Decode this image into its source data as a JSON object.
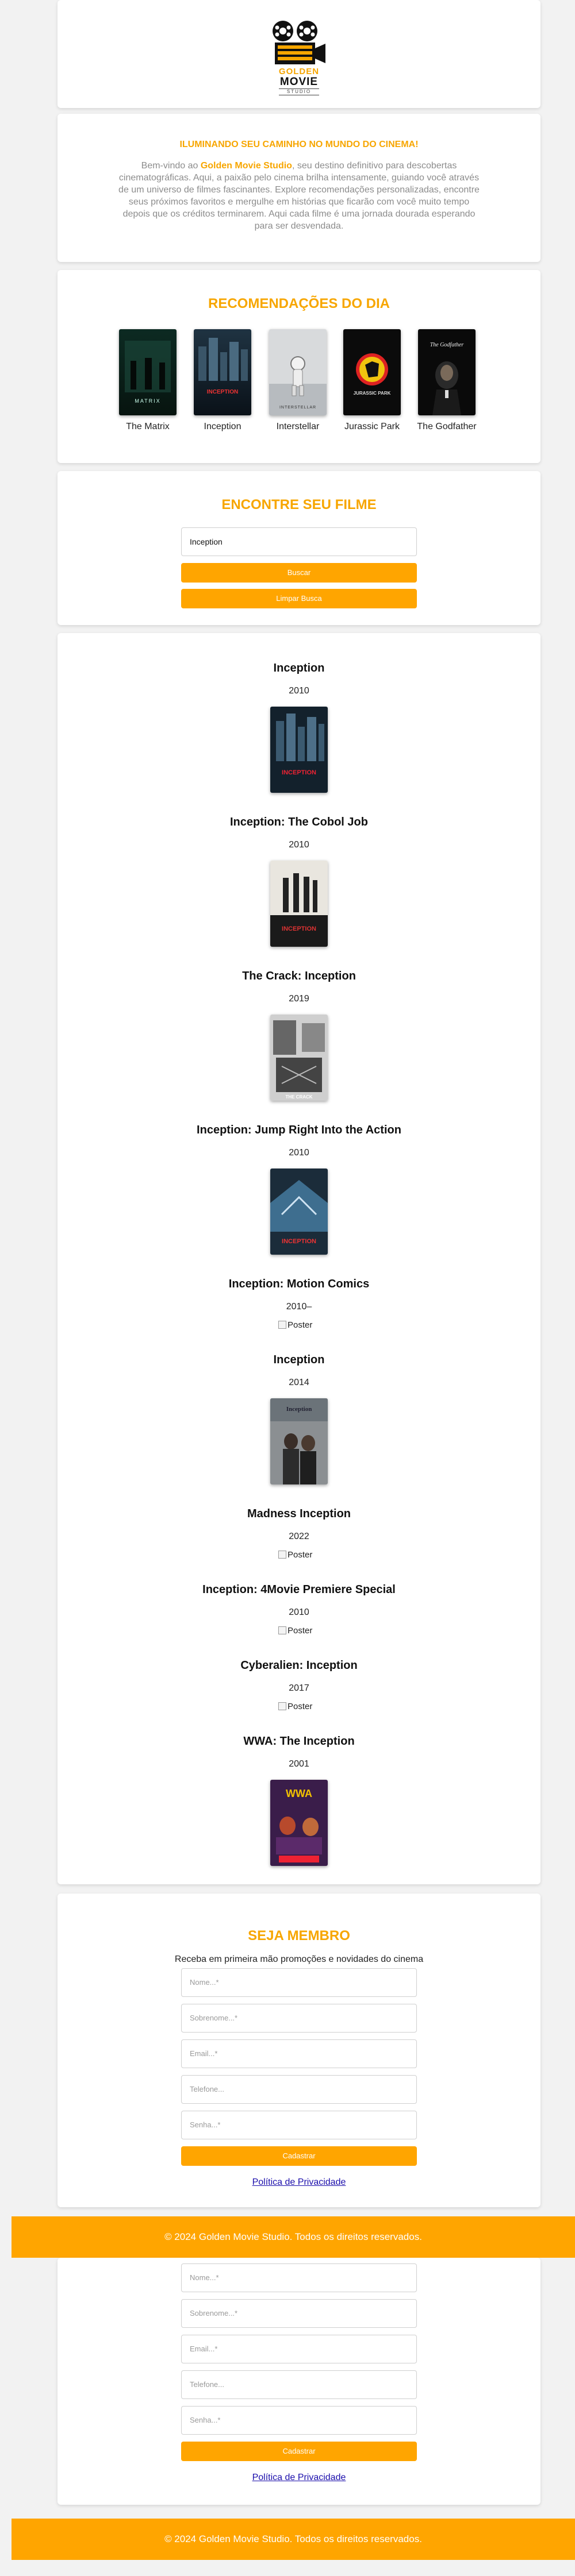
{
  "brand": {
    "logo_line1": "GOLDEN",
    "logo_line2": "MOVIE",
    "logo_line3": "STUDIO",
    "accent": "#ffa500"
  },
  "intro": {
    "headline": "ILUMINANDO SEU CAMINHO NO MUNDO DO CINEMA!",
    "text_before": "Bem-vindo ao ",
    "brand_name": "Golden Movie Studio",
    "text_after": ", seu destino definitivo para descobertas cinematográficas. Aqui, a paixão pelo cinema brilha intensamente, guiando você através de um universo de filmes fascinantes. Explore recomendações personalizadas, encontre seus próximos favoritos e mergulhe em histórias que ficarão com você muito tempo depois que os créditos terminarem. Aqui cada filme é uma jornada dourada esperando para ser desvendada."
  },
  "recommendations": {
    "title": "RECOMENDAÇÕES DO DIA",
    "items": [
      {
        "name": "The Matrix",
        "poster_text": "MATRIX"
      },
      {
        "name": "Inception",
        "poster_text": "INCEPTION"
      },
      {
        "name": "Interstellar",
        "poster_text": "INTERSTELLAR"
      },
      {
        "name": "Jurassic Park",
        "poster_text": "JURASSIC PARK"
      },
      {
        "name": "The Godfather",
        "poster_text": "The Godfather"
      }
    ]
  },
  "search": {
    "title": "ENCONTRE SEU FILME",
    "value": "Inception",
    "search_button": "Buscar",
    "clear_button": "Limpar Busca"
  },
  "results": [
    {
      "title": "Inception",
      "year": "2010",
      "poster_text": "INCEPTION"
    },
    {
      "title": "Inception: The Cobol Job",
      "year": "2010",
      "poster_text": "INCEPTION"
    },
    {
      "title": "The Crack: Inception",
      "year": "2019",
      "poster_text": "THE CRACK"
    },
    {
      "title": "Inception: Jump Right Into the Action",
      "year": "2010",
      "poster_text": "INCEPTION"
    },
    {
      "title": "Inception: Motion Comics",
      "year": "2010–",
      "broken_alt": "Poster"
    },
    {
      "title": "Inception",
      "year": "2014",
      "poster_text": "Inception"
    },
    {
      "title": "Madness Inception",
      "year": "2022",
      "broken_alt": "Poster"
    },
    {
      "title": "Inception: 4Movie Premiere Special",
      "year": "2010",
      "broken_alt": "Poster"
    },
    {
      "title": "Cyberalien: Inception",
      "year": "2017",
      "broken_alt": "Poster"
    },
    {
      "title": "WWA: The Inception",
      "year": "2001",
      "poster_text": "WWA"
    }
  ],
  "membership": {
    "title": "SEJA MEMBRO",
    "subtitle": "Receba em primeira mão promoções e novidades do cinema",
    "fields": {
      "nome": "Nome...*",
      "sobrenome": "Sobrenome...*",
      "email": "Email...*",
      "telefone": "Telefone...",
      "senha": "Senha...*"
    },
    "submit": "Cadastrar",
    "privacy": "Política de Privacidade"
  },
  "footer": {
    "text": "© 2024 Golden Movie Studio. Todos os direitos reservados."
  }
}
